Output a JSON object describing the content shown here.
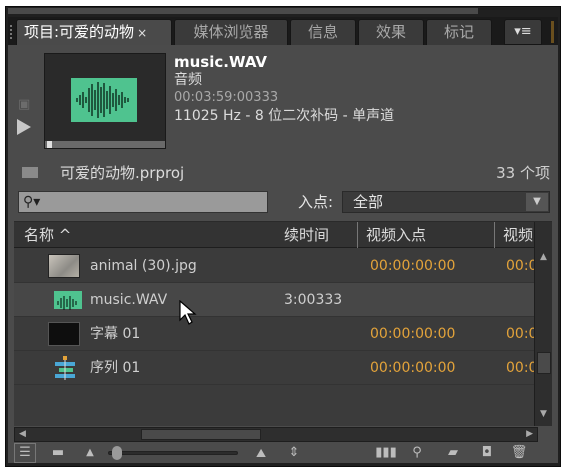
{
  "tabs": [
    {
      "label": "项目:可爱的动物",
      "close": "×",
      "active": true
    },
    {
      "label": "媒体浏览器"
    },
    {
      "label": "信息"
    },
    {
      "label": "效果"
    },
    {
      "label": "标记"
    }
  ],
  "panel_menu_icon": "▾≡",
  "preview": {
    "filename": "music.WAV",
    "type": "音频",
    "duration": "00:03:59:00333",
    "format": "11025 Hz - 8 位二次补码 - 单声道"
  },
  "project": {
    "name": "可爱的动物.prproj",
    "item_count": "33 个项"
  },
  "search": {
    "placeholder": "",
    "icon": "⚲▾"
  },
  "in_point": {
    "label": "入点:",
    "value": "全部"
  },
  "columns": {
    "name": "名称",
    "sort_arrow": "^",
    "duration": "续时间",
    "video_in": "视频入点",
    "video_out": "视频出"
  },
  "rows": [
    {
      "name": "animal (30).jpg",
      "icon": "image-thumbnail",
      "duration": "",
      "video_in": "00:00:00:00",
      "video_out": "00:0"
    },
    {
      "name": "music.WAV",
      "icon": "audio-waveform",
      "duration": "3:00333",
      "video_in": "",
      "video_out": ""
    },
    {
      "name": "字幕 01",
      "icon": "title-thumbnail",
      "duration": "",
      "video_in": "00:00:00:00",
      "video_out": "00:0"
    },
    {
      "name": "序列 01",
      "icon": "sequence-icon",
      "duration": "",
      "video_in": "00:00:00:00",
      "video_out": "00:0"
    }
  ],
  "colors": {
    "timecode": "#e3a33a",
    "wave_green": "#4fc38f"
  }
}
